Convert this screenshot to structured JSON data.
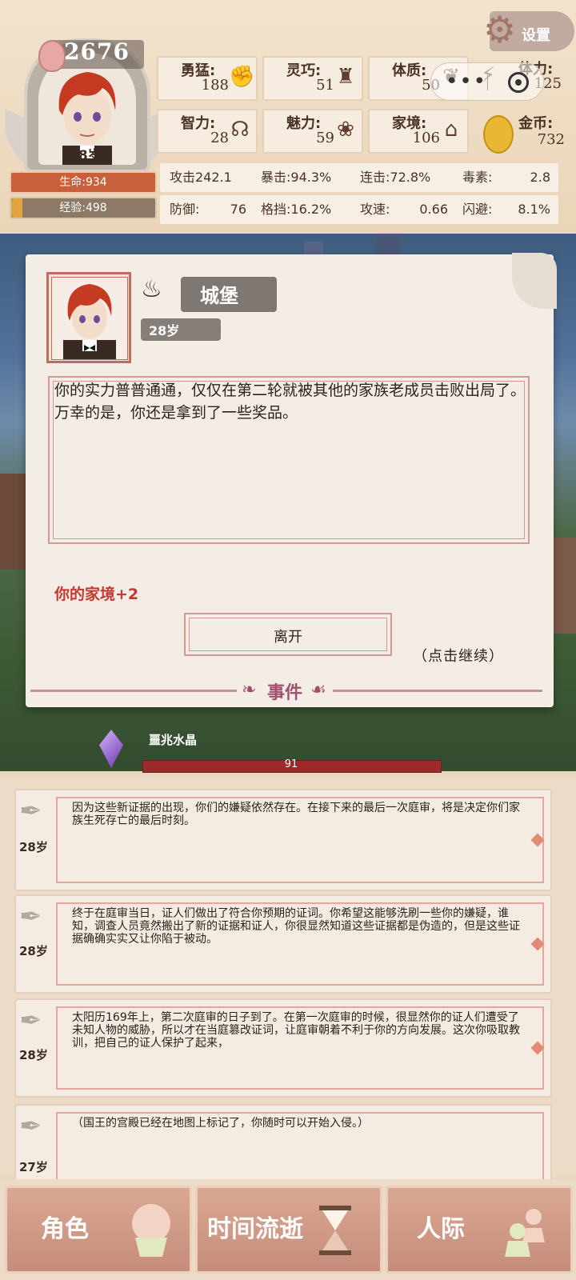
{
  "player": {
    "score": "2676",
    "age": "28岁",
    "hp_label": "生命:934",
    "xp_label": "经验:498",
    "xp_fraction": 0.08
  },
  "stats": [
    {
      "label": "勇猛:",
      "value": "188",
      "icon": "fist-icon"
    },
    {
      "label": "灵巧:",
      "value": "51",
      "icon": "cloak-icon"
    },
    {
      "label": "体质:",
      "value": "50",
      "icon": "stomach-icon"
    },
    {
      "label": "体力:",
      "value": "125",
      "icon": "lightning-icon"
    },
    {
      "label": "智力:",
      "value": "28",
      "icon": "brain-icon"
    },
    {
      "label": "魅力:",
      "value": "59",
      "icon": "flower-icon"
    },
    {
      "label": "家境:",
      "value": "106",
      "icon": "house-icon"
    },
    {
      "label": "金币:",
      "value": "732",
      "icon": "coin-icon"
    }
  ],
  "combat": [
    {
      "label": "攻击242.1",
      "value": ""
    },
    {
      "label": "暴击:94.3%",
      "value": ""
    },
    {
      "label": "连击:72.8%",
      "value": ""
    },
    {
      "label": "毒素:",
      "value": "2.8"
    },
    {
      "label": "防御:",
      "value": "76"
    },
    {
      "label": "格挡:16.2%",
      "value": ""
    },
    {
      "label": "攻速:",
      "value": "0.66"
    },
    {
      "label": "闪避:",
      "value": "8.1%"
    }
  ],
  "settings_label": "设置",
  "event": {
    "location": "城堡",
    "age": "28岁",
    "story": "你的实力普普通通，仅仅在第二轮就被其他的家族老成员击败出局了。万幸的是，你还是拿到了一些奖品。",
    "reward": "你的家境+2",
    "leave_label": "离开",
    "continue_label": "（点击继续）",
    "section_title": "事件"
  },
  "crystal": {
    "label": "噩兆水晶",
    "value": "91"
  },
  "log": [
    {
      "age": "28岁",
      "text": "因为这些新证据的出现，你们的嫌疑依然存在。在接下来的最后一次庭审，将是决定你们家族生死存亡的最后时刻。"
    },
    {
      "age": "28岁",
      "text": "终于在庭审当日，证人们做出了符合你预期的证词。你希望这能够洗刷一些你的嫌疑，谁知，调查人员竟然搬出了新的证据和证人，你很显然知道这些证据都是伪造的，但是这些证据确确实实又让你陷于被动。"
    },
    {
      "age": "28岁",
      "text": "太阳历169年上，第二次庭审的日子到了。在第一次庭审的时候，很显然你的证人们遭受了未知人物的威胁，所以才在当庭篡改证词，让庭审朝着不利于你的方向发展。这次你吸取教训，把自己的证人保护了起来，"
    },
    {
      "age": "27岁",
      "text": "（国王的宫殿已经在地图上标记了，你随时可以开始入侵。）"
    }
  ],
  "nav": [
    {
      "label": "角色",
      "icon": "character-icon"
    },
    {
      "label": "时间流逝",
      "icon": "hourglass-icon"
    },
    {
      "label": "人际",
      "icon": "people-icon"
    }
  ]
}
